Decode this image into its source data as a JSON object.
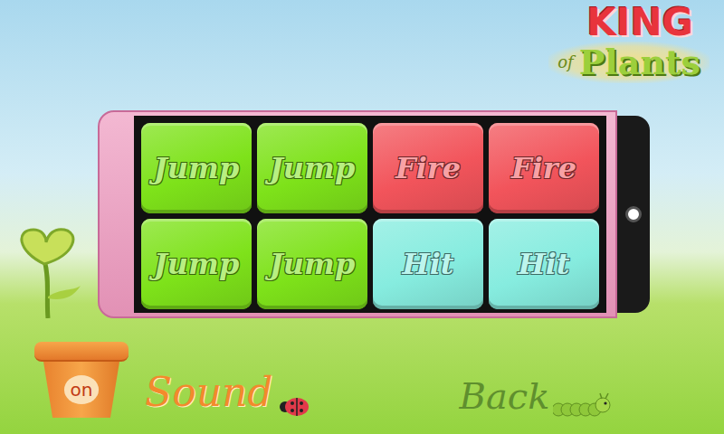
{
  "logo": {
    "top": "KING",
    "small": "of",
    "main": "Plants"
  },
  "buttons": [
    {
      "label": "Jump",
      "color": "#7ee21a"
    },
    {
      "label": "Jump",
      "color": "#7ee21a"
    },
    {
      "label": "Fire",
      "color": "#f2545b"
    },
    {
      "label": "Fire",
      "color": "#f2545b"
    },
    {
      "label": "Jump",
      "color": "#7ee21a"
    },
    {
      "label": "Jump",
      "color": "#7ee21a"
    },
    {
      "label": "Hit",
      "color": "#86ecdf"
    },
    {
      "label": "Hit",
      "color": "#86ecdf"
    }
  ],
  "sound": {
    "label": "Sound",
    "state": "on",
    "on": true
  },
  "back": {
    "label": "Back"
  }
}
